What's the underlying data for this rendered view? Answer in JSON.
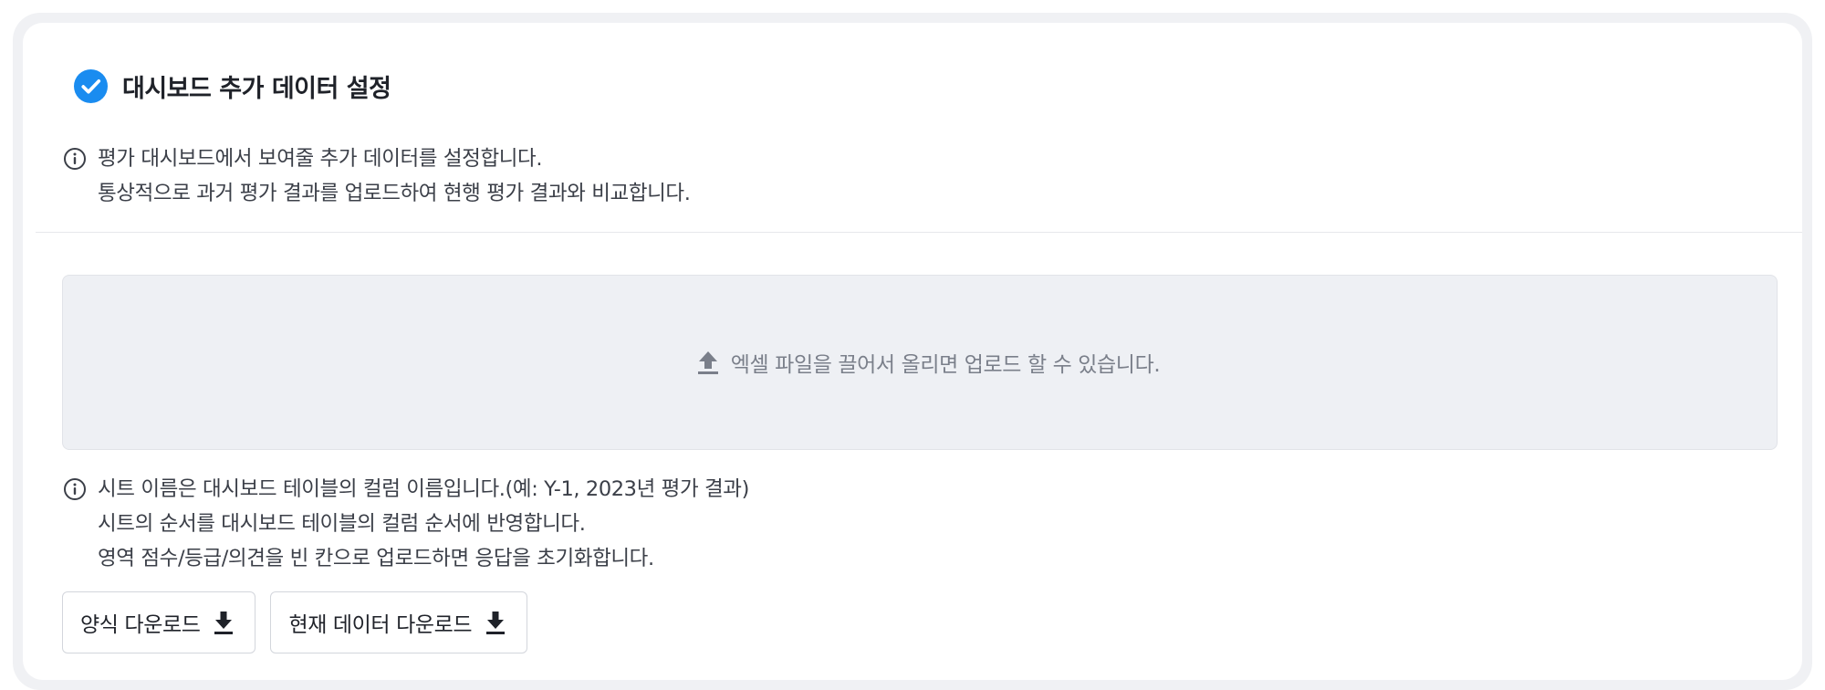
{
  "section": {
    "title": "대시보드 추가 데이터 설정",
    "check_icon": "check-circle-icon",
    "accent_color": "#1a8cf0"
  },
  "description": {
    "icon": "info-icon",
    "lines": [
      "평가 대시보드에서 보여줄 추가 데이터를 설정합니다.",
      "통상적으로 과거 평가 결과를 업로드하여 현행 평가 결과와 비교합니다."
    ]
  },
  "dropzone": {
    "icon": "upload-icon",
    "text": "엑셀 파일을 끌어서 올리면 업로드 할 수 있습니다."
  },
  "sheet_info": {
    "icon": "info-icon",
    "lines": [
      "시트 이름은 대시보드 테이블의 컬럼 이름입니다.(예: Y-1, 2023년 평가 결과)",
      "시트의 순서를 대시보드 테이블의 컬럼 순서에 반영합니다.",
      "영역 점수/등급/의견을 빈 칸으로 업로드하면 응답을 초기화합니다."
    ]
  },
  "buttons": {
    "template_download": "양식 다운로드",
    "current_data_download": "현재 데이터 다운로드",
    "icon": "download-icon"
  }
}
